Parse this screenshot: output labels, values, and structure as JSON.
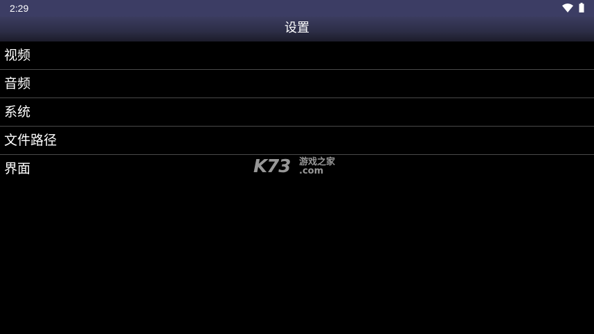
{
  "status_bar": {
    "time": "2:29",
    "icons": [
      "wifi-icon",
      "battery-icon"
    ]
  },
  "header": {
    "title": "设置"
  },
  "settings": {
    "items": [
      {
        "label": "视频"
      },
      {
        "label": "音频"
      },
      {
        "label": "系统"
      },
      {
        "label": "文件路径"
      },
      {
        "label": "界面"
      }
    ]
  },
  "watermark": {
    "logo": "K73",
    "brand": "游戏之家",
    "domain": ".com"
  },
  "colors": {
    "status_bar": "#3c3d64",
    "title_bar": "#2c2d46",
    "background": "#000000",
    "divider": "#4a4a4a",
    "text": "#ffffff"
  }
}
